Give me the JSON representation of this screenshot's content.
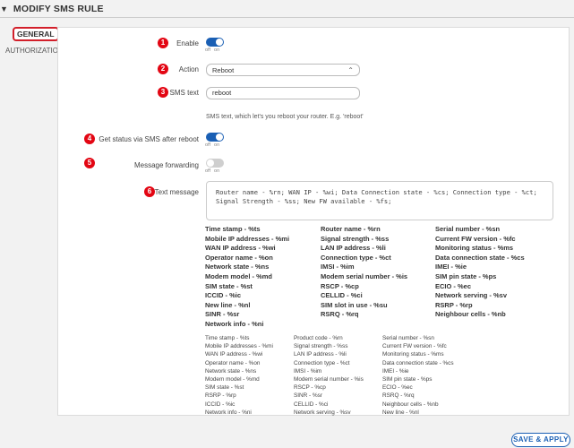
{
  "header": {
    "title": "MODIFY SMS RULE",
    "chevron_icon": "chevron-down-icon"
  },
  "tabs": {
    "general": "GENERAL",
    "authorization": "AUTHORIZATION"
  },
  "fields": {
    "enable": {
      "badge": "1",
      "label": "Enable",
      "state": "on",
      "off_label": "off",
      "on_label": "on"
    },
    "action": {
      "badge": "2",
      "label": "Action",
      "value": "Reboot"
    },
    "sms_text": {
      "badge": "3",
      "label": "SMS text",
      "value": "reboot",
      "helper": "SMS text, which let's you reboot your router. E.g. 'reboot'"
    },
    "get_status": {
      "badge": "4",
      "label": "Get status via SMS after reboot",
      "state": "on",
      "off_label": "off",
      "on_label": "on"
    },
    "message_forwarding": {
      "badge": "5",
      "label": "Message forwarding",
      "state": "off",
      "off_label": "off",
      "on_label": "on"
    },
    "text_message": {
      "badge": "6",
      "label": "Text message",
      "line1": "Router name - %rn; WAN IP - %wi; Data Connection state - %cs; Connection type - %ct;",
      "line2": "Signal Strength - %ss; New FW available - %fs;"
    }
  },
  "vars_bold": [
    [
      "Time stamp - %ts",
      "Mobile IP addresses - %mi",
      "WAN IP address - %wi",
      "Operator name - %on",
      "Network state - %ns",
      "Modem model - %md",
      "SIM state - %st",
      "ICCID - %ic",
      "New line - %nl",
      "SINR - %sr",
      "Network info - %ni"
    ],
    [
      "Router name - %rn",
      "Signal strength - %ss",
      "LAN IP address - %li",
      "Connection type - %ct",
      "IMSI - %im",
      "Modem serial number - %is",
      "RSCP - %cp",
      "CELLID - %ci",
      "SIM slot in use - %su",
      "RSRQ - %rq"
    ],
    [
      "Serial number - %sn",
      "Current FW version - %fc",
      "Monitoring status - %ms",
      "Data connection state - %cs",
      "IMEI - %ie",
      "SIM pin state - %ps",
      "ECIO - %ec",
      "Network serving - %sv",
      "RSRP - %rp",
      "Neighbour cells - %nb"
    ]
  ],
  "vars_small": [
    [
      "Time stamp - %ts",
      "Mobile IP addresses - %mi",
      "WAN IP address - %wi",
      "Operator name - %on",
      "Network state - %ns",
      "Modem model - %md",
      "SIM state - %st",
      "RSRP - %rp",
      "ICCID - %ic",
      "Network info - %ni"
    ],
    [
      "Product code - %rn",
      "Signal strength - %ss",
      "LAN IP address - %li",
      "Connection type - %ct",
      "IMSI - %im",
      "Modem serial number - %is",
      "RSCP - %cp",
      "SINR - %sr",
      "CELLID - %ci",
      "Network serving - %sv"
    ],
    [
      "Serial number - %sn",
      "Current FW version - %fc",
      "Monitoring status - %ms",
      "Data connection state - %cs",
      "IMEI - %ie",
      "SIM pin state - %ps",
      "ECIO - %ec",
      "RSRQ - %rq",
      "Neighbour cells - %nb",
      "New line - %nl"
    ]
  ],
  "footer": {
    "save_label": "SAVE & APPLY"
  },
  "colors": {
    "accent": "#1a5fb4",
    "badge": "#e30613",
    "tab_highlight": "#d21f2a"
  }
}
